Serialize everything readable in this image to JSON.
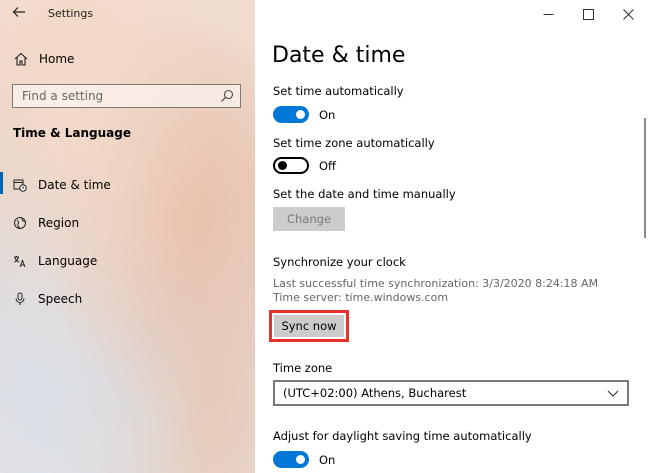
{
  "window": {
    "title": "Settings",
    "controls": {
      "minimize": "—",
      "maximize": "☐",
      "close": "✕"
    }
  },
  "sidebar": {
    "home_label": "Home",
    "search_placeholder": "Find a setting",
    "section_title": "Time & Language",
    "items": [
      {
        "label": "Date & time",
        "icon": "calendar-clock-icon",
        "active": true
      },
      {
        "label": "Region",
        "icon": "globe-icon",
        "active": false
      },
      {
        "label": "Language",
        "icon": "language-icon",
        "active": false
      },
      {
        "label": "Speech",
        "icon": "microphone-icon",
        "active": false
      }
    ]
  },
  "main": {
    "title": "Date & time",
    "set_time_auto": {
      "label": "Set time automatically",
      "state": "On"
    },
    "set_timezone_auto": {
      "label": "Set time zone automatically",
      "state": "Off"
    },
    "manual": {
      "label": "Set the date and time manually",
      "button": "Change"
    },
    "sync": {
      "heading": "Synchronize your clock",
      "last_sync": "Last successful time synchronization: 3/3/2020 8:24:18 AM",
      "server": "Time server: time.windows.com",
      "button": "Sync now"
    },
    "timezone": {
      "label": "Time zone",
      "value": "(UTC+02:00) Athens, Bucharest"
    },
    "dst": {
      "label": "Adjust for daylight saving time automatically",
      "state": "On"
    }
  },
  "colors": {
    "accent": "#0078d7",
    "highlight": "#e8312a",
    "active_bar": "#0063b1"
  }
}
